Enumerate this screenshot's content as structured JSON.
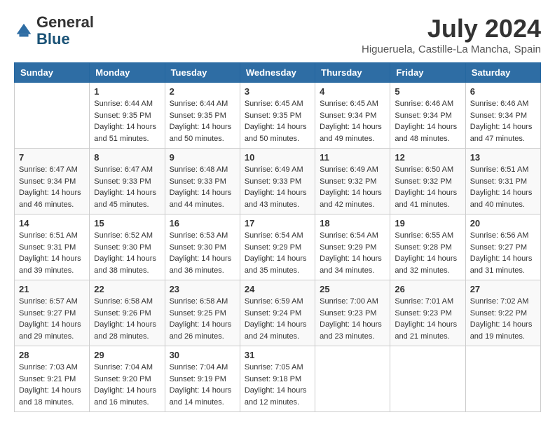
{
  "logo": {
    "general": "General",
    "blue": "Blue"
  },
  "header": {
    "month": "July 2024",
    "location": "Higueruela, Castille-La Mancha, Spain"
  },
  "weekdays": [
    "Sunday",
    "Monday",
    "Tuesday",
    "Wednesday",
    "Thursday",
    "Friday",
    "Saturday"
  ],
  "weeks": [
    [
      {
        "day": "",
        "sunrise": "",
        "sunset": "",
        "daylight": ""
      },
      {
        "day": "1",
        "sunrise": "Sunrise: 6:44 AM",
        "sunset": "Sunset: 9:35 PM",
        "daylight": "Daylight: 14 hours and 51 minutes."
      },
      {
        "day": "2",
        "sunrise": "Sunrise: 6:44 AM",
        "sunset": "Sunset: 9:35 PM",
        "daylight": "Daylight: 14 hours and 50 minutes."
      },
      {
        "day": "3",
        "sunrise": "Sunrise: 6:45 AM",
        "sunset": "Sunset: 9:35 PM",
        "daylight": "Daylight: 14 hours and 50 minutes."
      },
      {
        "day": "4",
        "sunrise": "Sunrise: 6:45 AM",
        "sunset": "Sunset: 9:34 PM",
        "daylight": "Daylight: 14 hours and 49 minutes."
      },
      {
        "day": "5",
        "sunrise": "Sunrise: 6:46 AM",
        "sunset": "Sunset: 9:34 PM",
        "daylight": "Daylight: 14 hours and 48 minutes."
      },
      {
        "day": "6",
        "sunrise": "Sunrise: 6:46 AM",
        "sunset": "Sunset: 9:34 PM",
        "daylight": "Daylight: 14 hours and 47 minutes."
      }
    ],
    [
      {
        "day": "7",
        "sunrise": "Sunrise: 6:47 AM",
        "sunset": "Sunset: 9:34 PM",
        "daylight": "Daylight: 14 hours and 46 minutes."
      },
      {
        "day": "8",
        "sunrise": "Sunrise: 6:47 AM",
        "sunset": "Sunset: 9:33 PM",
        "daylight": "Daylight: 14 hours and 45 minutes."
      },
      {
        "day": "9",
        "sunrise": "Sunrise: 6:48 AM",
        "sunset": "Sunset: 9:33 PM",
        "daylight": "Daylight: 14 hours and 44 minutes."
      },
      {
        "day": "10",
        "sunrise": "Sunrise: 6:49 AM",
        "sunset": "Sunset: 9:33 PM",
        "daylight": "Daylight: 14 hours and 43 minutes."
      },
      {
        "day": "11",
        "sunrise": "Sunrise: 6:49 AM",
        "sunset": "Sunset: 9:32 PM",
        "daylight": "Daylight: 14 hours and 42 minutes."
      },
      {
        "day": "12",
        "sunrise": "Sunrise: 6:50 AM",
        "sunset": "Sunset: 9:32 PM",
        "daylight": "Daylight: 14 hours and 41 minutes."
      },
      {
        "day": "13",
        "sunrise": "Sunrise: 6:51 AM",
        "sunset": "Sunset: 9:31 PM",
        "daylight": "Daylight: 14 hours and 40 minutes."
      }
    ],
    [
      {
        "day": "14",
        "sunrise": "Sunrise: 6:51 AM",
        "sunset": "Sunset: 9:31 PM",
        "daylight": "Daylight: 14 hours and 39 minutes."
      },
      {
        "day": "15",
        "sunrise": "Sunrise: 6:52 AM",
        "sunset": "Sunset: 9:30 PM",
        "daylight": "Daylight: 14 hours and 38 minutes."
      },
      {
        "day": "16",
        "sunrise": "Sunrise: 6:53 AM",
        "sunset": "Sunset: 9:30 PM",
        "daylight": "Daylight: 14 hours and 36 minutes."
      },
      {
        "day": "17",
        "sunrise": "Sunrise: 6:54 AM",
        "sunset": "Sunset: 9:29 PM",
        "daylight": "Daylight: 14 hours and 35 minutes."
      },
      {
        "day": "18",
        "sunrise": "Sunrise: 6:54 AM",
        "sunset": "Sunset: 9:29 PM",
        "daylight": "Daylight: 14 hours and 34 minutes."
      },
      {
        "day": "19",
        "sunrise": "Sunrise: 6:55 AM",
        "sunset": "Sunset: 9:28 PM",
        "daylight": "Daylight: 14 hours and 32 minutes."
      },
      {
        "day": "20",
        "sunrise": "Sunrise: 6:56 AM",
        "sunset": "Sunset: 9:27 PM",
        "daylight": "Daylight: 14 hours and 31 minutes."
      }
    ],
    [
      {
        "day": "21",
        "sunrise": "Sunrise: 6:57 AM",
        "sunset": "Sunset: 9:27 PM",
        "daylight": "Daylight: 14 hours and 29 minutes."
      },
      {
        "day": "22",
        "sunrise": "Sunrise: 6:58 AM",
        "sunset": "Sunset: 9:26 PM",
        "daylight": "Daylight: 14 hours and 28 minutes."
      },
      {
        "day": "23",
        "sunrise": "Sunrise: 6:58 AM",
        "sunset": "Sunset: 9:25 PM",
        "daylight": "Daylight: 14 hours and 26 minutes."
      },
      {
        "day": "24",
        "sunrise": "Sunrise: 6:59 AM",
        "sunset": "Sunset: 9:24 PM",
        "daylight": "Daylight: 14 hours and 24 minutes."
      },
      {
        "day": "25",
        "sunrise": "Sunrise: 7:00 AM",
        "sunset": "Sunset: 9:23 PM",
        "daylight": "Daylight: 14 hours and 23 minutes."
      },
      {
        "day": "26",
        "sunrise": "Sunrise: 7:01 AM",
        "sunset": "Sunset: 9:23 PM",
        "daylight": "Daylight: 14 hours and 21 minutes."
      },
      {
        "day": "27",
        "sunrise": "Sunrise: 7:02 AM",
        "sunset": "Sunset: 9:22 PM",
        "daylight": "Daylight: 14 hours and 19 minutes."
      }
    ],
    [
      {
        "day": "28",
        "sunrise": "Sunrise: 7:03 AM",
        "sunset": "Sunset: 9:21 PM",
        "daylight": "Daylight: 14 hours and 18 minutes."
      },
      {
        "day": "29",
        "sunrise": "Sunrise: 7:04 AM",
        "sunset": "Sunset: 9:20 PM",
        "daylight": "Daylight: 14 hours and 16 minutes."
      },
      {
        "day": "30",
        "sunrise": "Sunrise: 7:04 AM",
        "sunset": "Sunset: 9:19 PM",
        "daylight": "Daylight: 14 hours and 14 minutes."
      },
      {
        "day": "31",
        "sunrise": "Sunrise: 7:05 AM",
        "sunset": "Sunset: 9:18 PM",
        "daylight": "Daylight: 14 hours and 12 minutes."
      },
      {
        "day": "",
        "sunrise": "",
        "sunset": "",
        "daylight": ""
      },
      {
        "day": "",
        "sunrise": "",
        "sunset": "",
        "daylight": ""
      },
      {
        "day": "",
        "sunrise": "",
        "sunset": "",
        "daylight": ""
      }
    ]
  ]
}
